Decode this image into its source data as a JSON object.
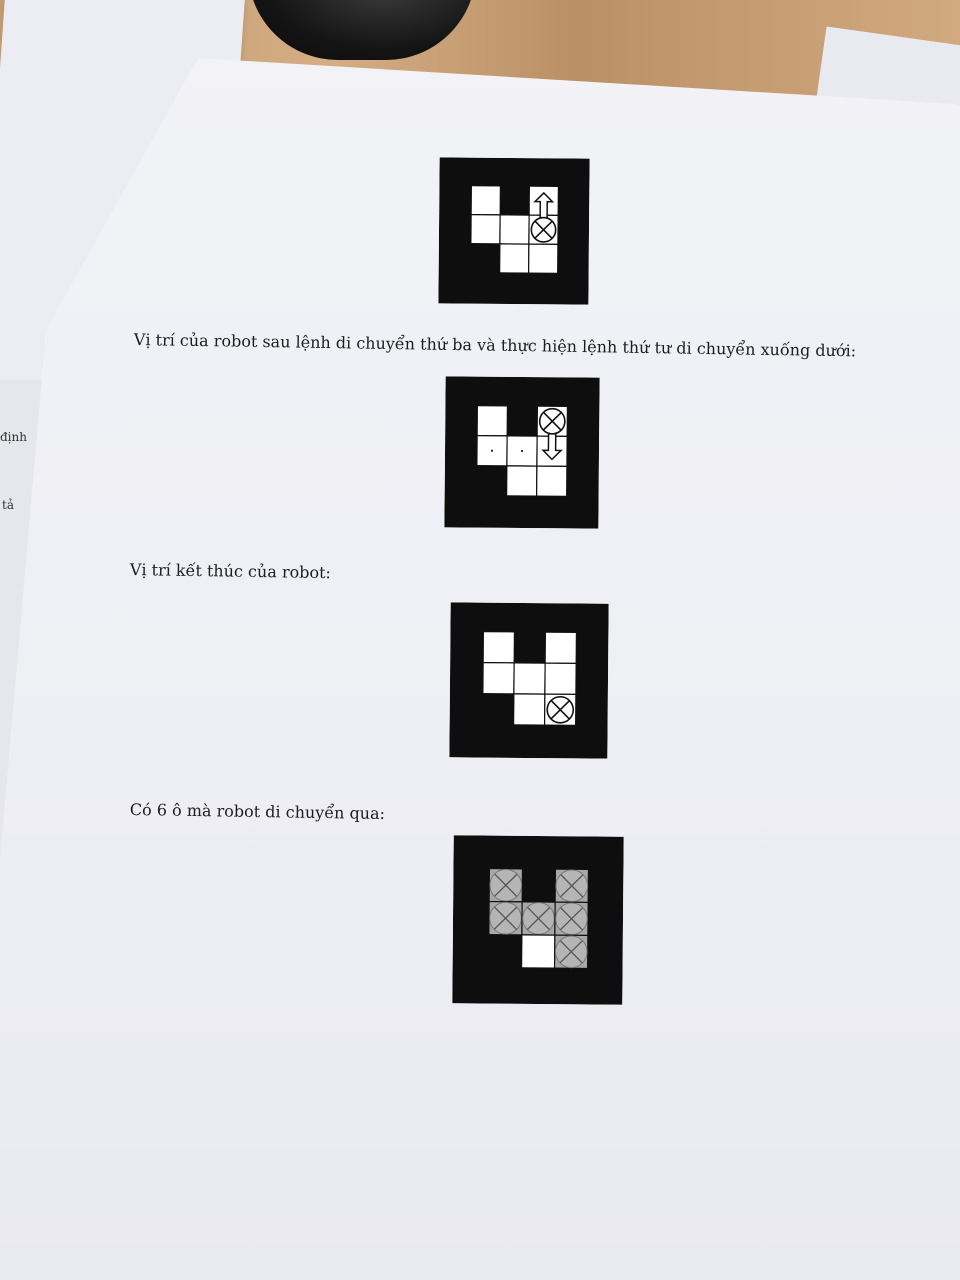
{
  "margin_text": {
    "left_fragment_1": "định",
    "left_fragment_2": "tả"
  },
  "captions": [
    "Vị trí của robot sau lệnh di chuyển thứ ba và thực hiện lệnh thứ tư di chuyển xuống dưới:",
    "Vị trí kết thúc của robot:",
    "Có 6 ô mà robot di chuyển qua:"
  ],
  "grid": {
    "cols": 3,
    "rows": 3,
    "white_cells": [
      [
        0,
        0
      ],
      [
        0,
        1
      ],
      [
        1,
        1
      ],
      [
        1,
        2
      ],
      [
        2,
        0
      ],
      [
        2,
        1
      ],
      [
        2,
        2
      ]
    ]
  },
  "figures": [
    {
      "robot": [
        2,
        1
      ],
      "arrow": "up",
      "dots": []
    },
    {
      "robot": [
        2,
        0
      ],
      "arrow": "down",
      "dots": [
        [
          0,
          1
        ],
        [
          1,
          1
        ]
      ]
    },
    {
      "robot": [
        2,
        2
      ],
      "arrow": "none",
      "dots": []
    },
    {
      "robot": null,
      "arrow": "none",
      "dots": [],
      "visited": [
        [
          0,
          0
        ],
        [
          0,
          1
        ],
        [
          1,
          1
        ],
        [
          2,
          0
        ],
        [
          2,
          1
        ],
        [
          2,
          2
        ]
      ]
    }
  ],
  "colors": {
    "board": "#0e0e0e",
    "cell": "#ffffff",
    "visited": "#a8a8a8",
    "line": "#111111"
  }
}
